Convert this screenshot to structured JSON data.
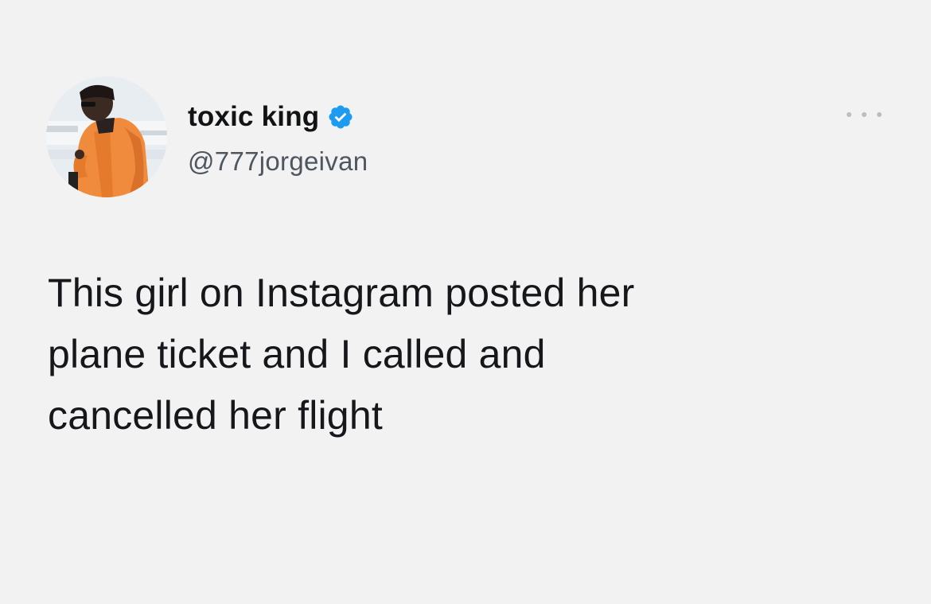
{
  "user": {
    "display_name": "toxic king",
    "handle": "@777jorgeivan",
    "verified": true,
    "verified_color": "#1d9bf0",
    "avatar_icon": "user-avatar-photo"
  },
  "tweet": {
    "text_lines": [
      "This girl on Instagram posted her",
      "plane ticket and I called and",
      "cancelled her flight"
    ]
  },
  "actions": {
    "more_icon": "more-options-icon"
  },
  "colors": {
    "background": "#f2f2f3",
    "text": "#15171a",
    "handle": "#4e5660",
    "avatar_jacket": "#f08a3c"
  }
}
